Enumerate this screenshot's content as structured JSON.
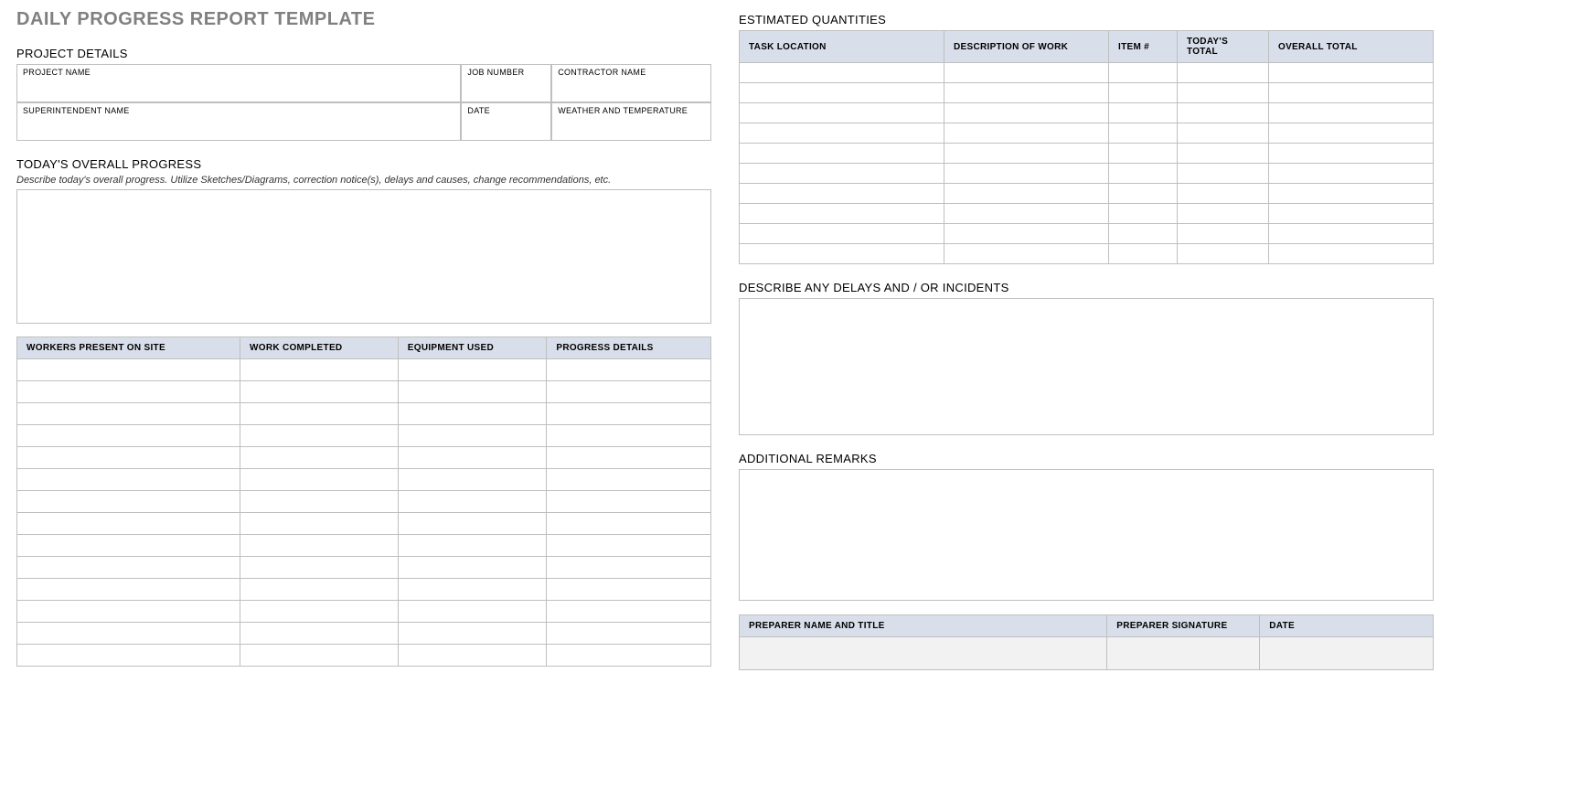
{
  "title": "DAILY PROGRESS REPORT TEMPLATE",
  "left": {
    "projectDetails": {
      "heading": "PROJECT DETAILS",
      "row1": {
        "c1": "PROJECT NAME",
        "c2": "JOB NUMBER",
        "c3": "CONTRACTOR NAME"
      },
      "row2": {
        "c1": "SUPERINTENDENT NAME",
        "c2": "DATE",
        "c3": "WEATHER AND TEMPERATURE"
      }
    },
    "overall": {
      "heading": "TODAY'S OVERALL PROGRESS",
      "hint": "Describe today's overall progress.  Utilize Sketches/Diagrams, correction notice(s), delays and causes, change recommendations, etc."
    },
    "progressTable": {
      "headers": [
        "WORKERS PRESENT ON SITE",
        "WORK COMPLETED",
        "EQUIPMENT USED",
        "PROGRESS DETAILS"
      ],
      "rowCount": 14
    }
  },
  "right": {
    "quantities": {
      "heading": "ESTIMATED QUANTITIES",
      "headers": [
        "TASK LOCATION",
        "DESCRIPTION OF WORK",
        "ITEM #",
        "TODAY'S TOTAL",
        "OVERALL TOTAL"
      ],
      "rowCount": 10
    },
    "delays": {
      "heading": "DESCRIBE ANY DELAYS AND / OR INCIDENTS"
    },
    "remarks": {
      "heading": "ADDITIONAL REMARKS"
    },
    "signature": {
      "headers": [
        "PREPARER NAME AND TITLE",
        "PREPARER SIGNATURE",
        "DATE"
      ]
    }
  }
}
